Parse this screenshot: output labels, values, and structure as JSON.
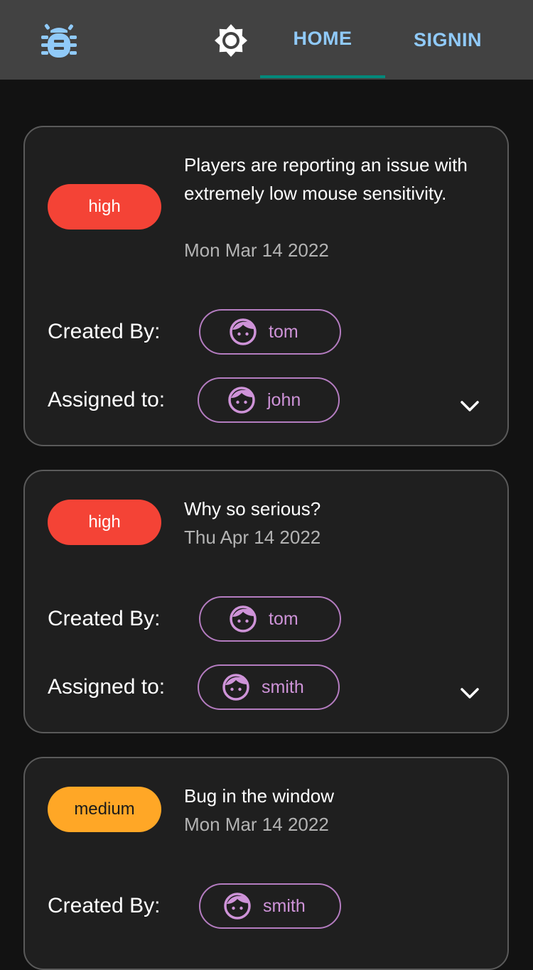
{
  "header": {
    "logo_icon": "bug-icon",
    "theme_icon": "brightness-icon",
    "tabs": [
      {
        "label": "HOME",
        "active": true
      },
      {
        "label": "SIGNIN",
        "active": false
      }
    ],
    "colors": {
      "appbar": "#424242",
      "tab_text": "#90caf9",
      "indicator": "#00897b"
    }
  },
  "labels": {
    "created_by": "Created By:",
    "assigned_to": "Assigned to:"
  },
  "bugs": [
    {
      "priority": "high",
      "description": "Players are reporting an issue with extremely low mouse sensitivity.",
      "date": "Mon Mar 14 2022",
      "created_by": "tom",
      "assigned_to": "john"
    },
    {
      "priority": "high",
      "description": "Why so serious?",
      "date": "Thu Apr 14 2022",
      "created_by": "tom",
      "assigned_to": "smith"
    },
    {
      "priority": "medium",
      "description": "Bug in the window",
      "date": "Mon Mar 14 2022",
      "created_by": "smith"
    }
  ],
  "colors": {
    "high": "#f44336",
    "medium": "#ffa726",
    "chip_text": "#ce93d8",
    "chip_border": "#b47cc0",
    "card_bg": "#1f1f1f",
    "page_bg": "#121212"
  }
}
